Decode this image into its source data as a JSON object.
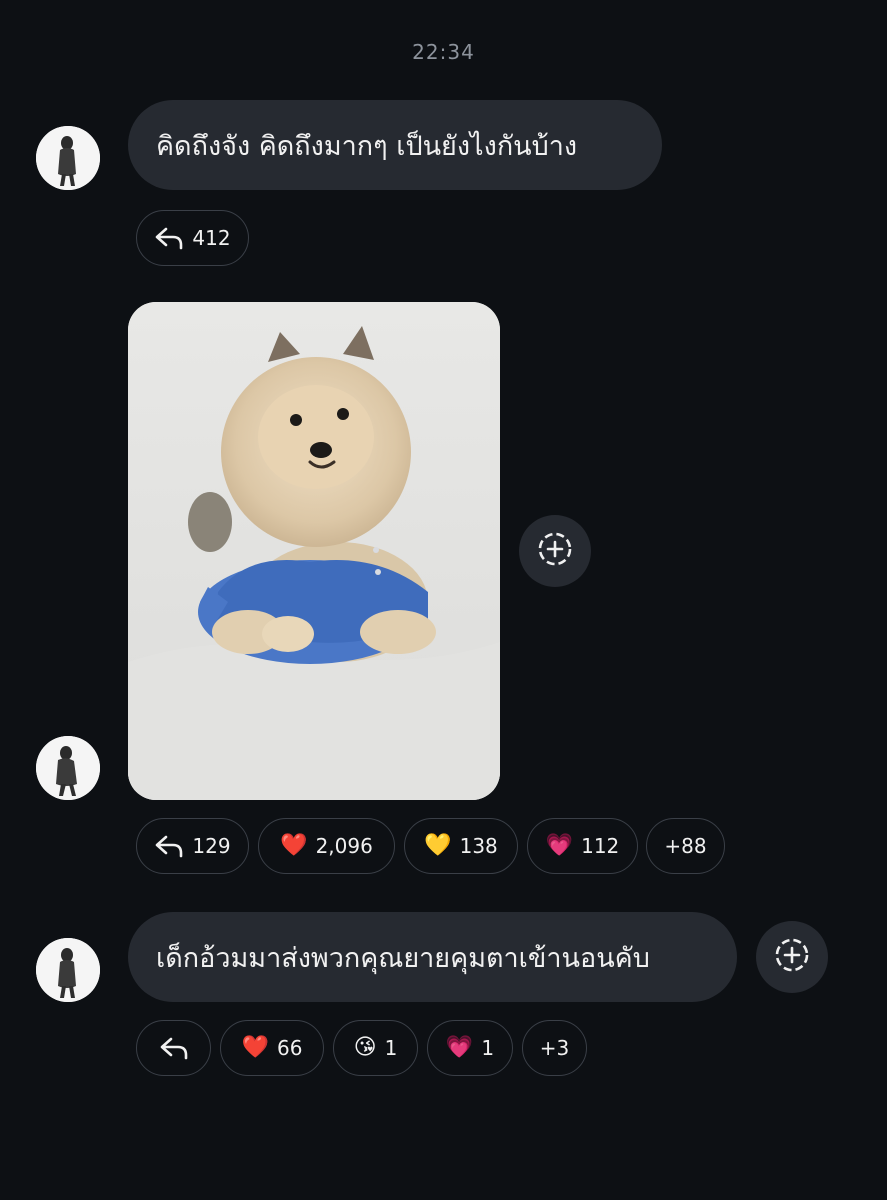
{
  "chat": {
    "timestamp": "22:34",
    "messages": [
      {
        "text": "คิดถึงจัง คิดถึงมากๆ เป็นยังไงกันบ้าง",
        "reply_count": "412"
      },
      {
        "image": "pomeranian-dog-in-blue-shirt",
        "reply_count": "129",
        "reactions": [
          {
            "emoji": "❤️",
            "count": "2,096"
          },
          {
            "emoji": "💛",
            "count": "138"
          },
          {
            "emoji": "💗",
            "count": "112"
          }
        ],
        "more_reactions": "+88"
      },
      {
        "text": "เด็กอ้วมมาส่งพวกคุณยายคุมตาเข้านอนคับ",
        "reply_count": "",
        "reactions": [
          {
            "emoji": "❤️",
            "count": "66"
          },
          {
            "emoji": "😘",
            "count": "1"
          },
          {
            "emoji": "💗",
            "count": "1"
          }
        ],
        "more_reactions": "+3"
      }
    ]
  },
  "colors": {
    "background": "#0d1014",
    "bubble": "#262a31",
    "pill_border": "#3a3f47",
    "timestamp": "#8d939c"
  },
  "icons": {
    "reply": "reply-arrow-icon",
    "add_reaction": "add-reaction-icon"
  }
}
